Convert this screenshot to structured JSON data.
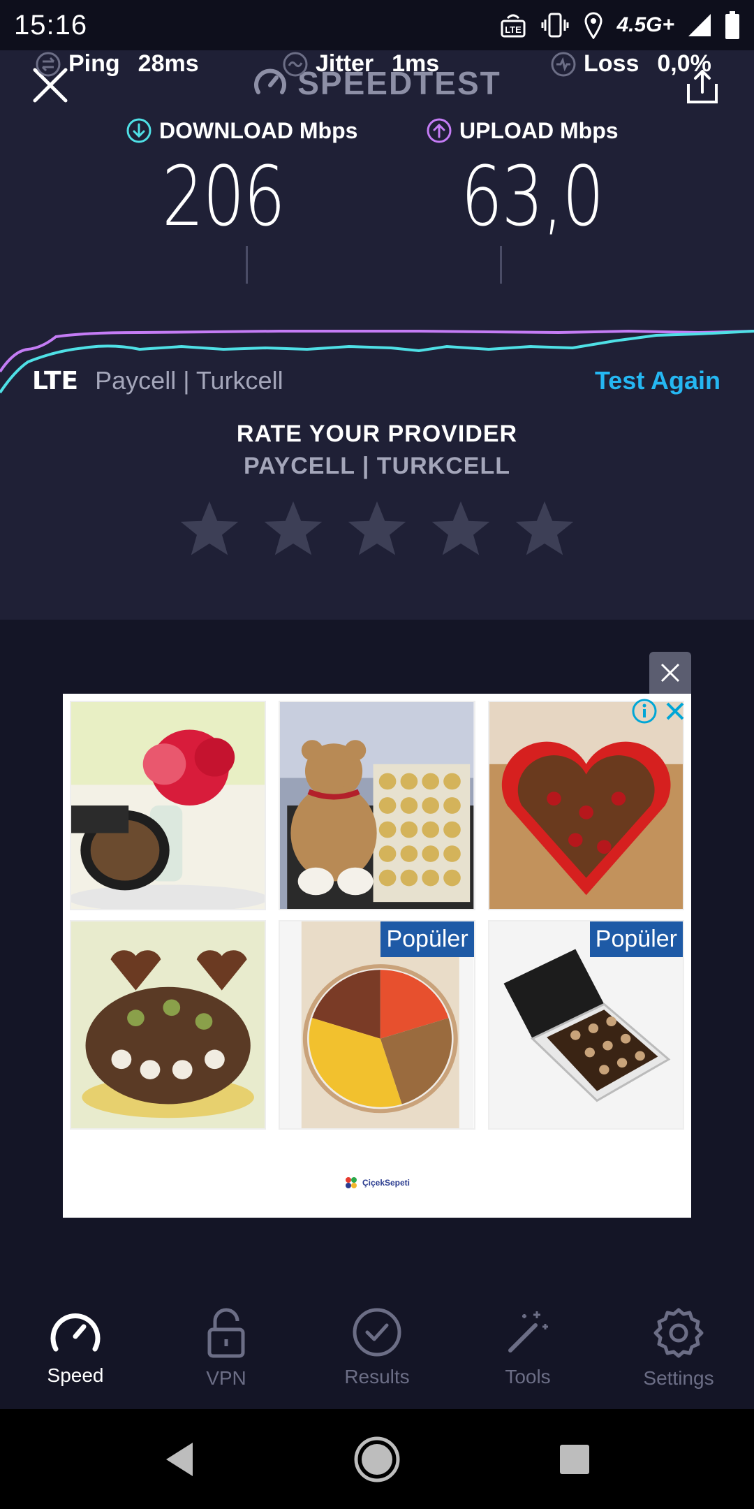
{
  "status_bar": {
    "time": "15:16",
    "network": "4.5G+"
  },
  "header": {
    "title": "SPEEDTEST"
  },
  "download": {
    "label": "DOWNLOAD Mbps",
    "value": "206"
  },
  "upload": {
    "label": "UPLOAD Mbps",
    "value": "63,0"
  },
  "stats": {
    "ping": {
      "label": "Ping",
      "value": "28ms"
    },
    "jitter": {
      "label": "Jitter",
      "value": "1ms"
    },
    "loss": {
      "label": "Loss",
      "value": "0,0%"
    }
  },
  "connection": {
    "type": "LTE",
    "provider": "Paycell | Turkcell",
    "test_again": "Test Again"
  },
  "rating": {
    "title": "RATE YOUR PROVIDER",
    "provider": "PAYCELL | TURKCELL",
    "stars": 5
  },
  "ad": {
    "badges": [
      "Popüler",
      "Popüler"
    ],
    "sponsor": "ÇiçekSepeti"
  },
  "bottom_nav": {
    "items": [
      {
        "label": "Speed"
      },
      {
        "label": "VPN"
      },
      {
        "label": "Results"
      },
      {
        "label": "Tools"
      },
      {
        "label": "Settings"
      }
    ]
  },
  "colors": {
    "accent_blue": "#25b7f2",
    "download_teal": "#4fe0e6",
    "upload_purple": "#c47cf5"
  }
}
